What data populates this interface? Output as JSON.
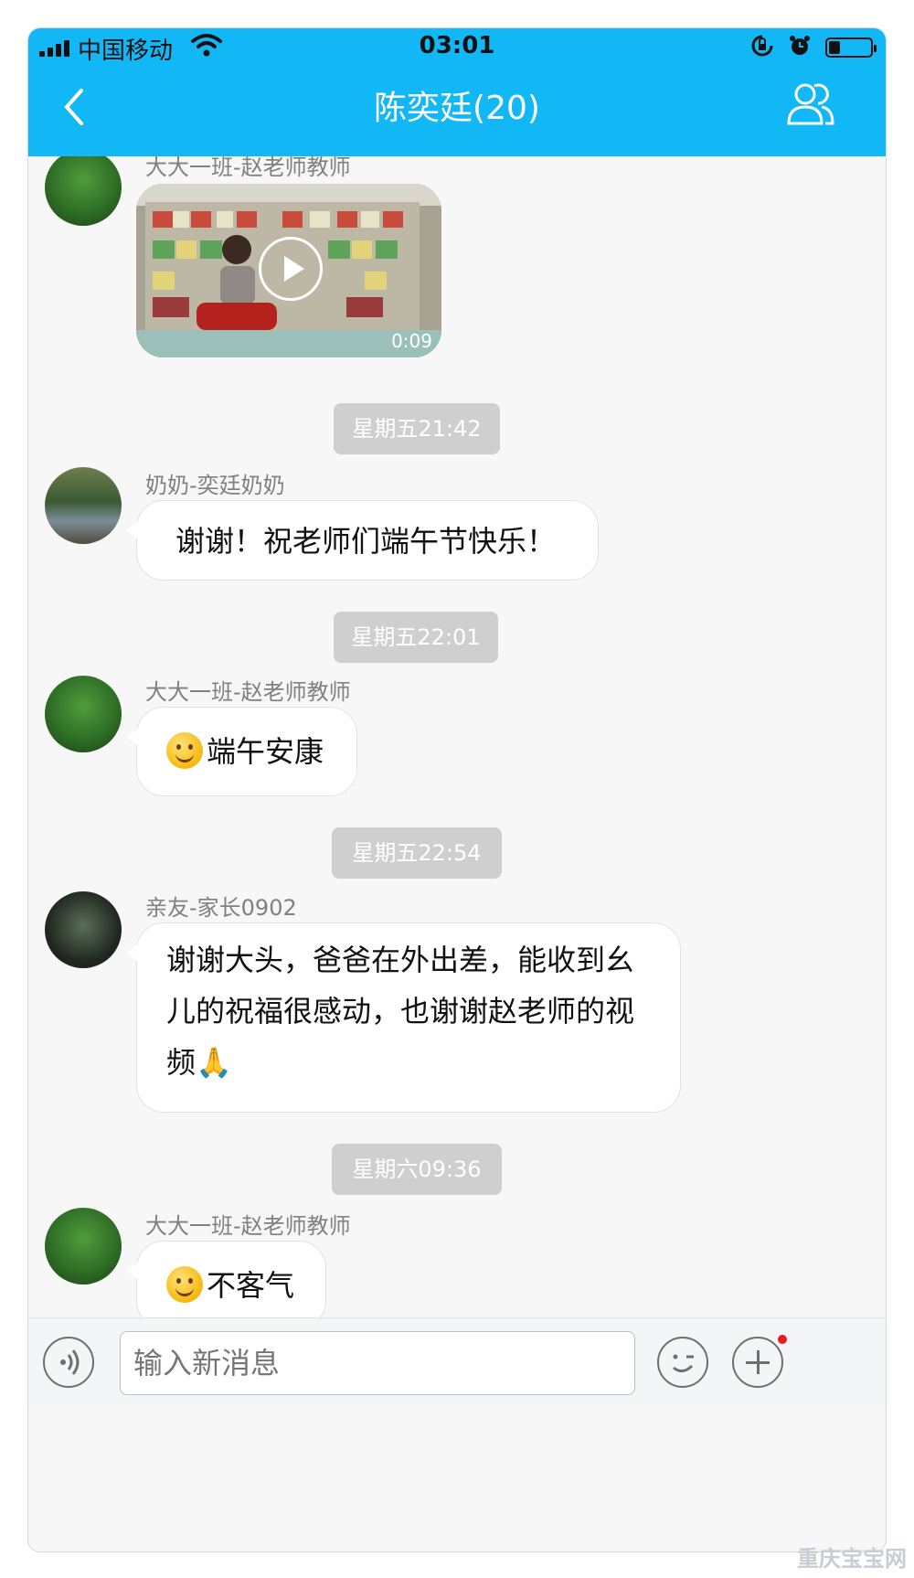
{
  "status_bar": {
    "carrier": "中国移动",
    "time": "03:01"
  },
  "header": {
    "title": "陈奕廷(20)"
  },
  "messages": [
    {
      "sender": "大大一班-赵老师教师",
      "video_duration": "0:09"
    },
    {
      "timestamp": "星期五21:42"
    },
    {
      "sender": "奶奶-奕廷奶奶",
      "text": "谢谢！祝老师们端午节快乐！"
    },
    {
      "timestamp": "星期五22:01"
    },
    {
      "sender": "大大一班-赵老师教师",
      "text": "端午安康",
      "emoji": "smirk-smile-emoji"
    },
    {
      "timestamp": "星期五22:54"
    },
    {
      "sender": "亲友-家长0902",
      "lines": [
        "谢谢大头，爸爸在外出差，能收到幺",
        "儿的祝福很感动，也谢谢赵老师的视",
        "频"
      ],
      "emoji": "folded-hands-emoji"
    },
    {
      "timestamp": "星期六09:36"
    },
    {
      "sender": "大大一班-赵老师教师",
      "text": "不客气",
      "emoji": "smile-emoji"
    }
  ],
  "input_bar": {
    "placeholder": "输入新消息"
  },
  "watermark": "重庆宝宝网",
  "colors": {
    "header_bg": "#12b7f5",
    "timestamp_bg": "#cfcfcf",
    "unread_dot": "#f01818"
  }
}
